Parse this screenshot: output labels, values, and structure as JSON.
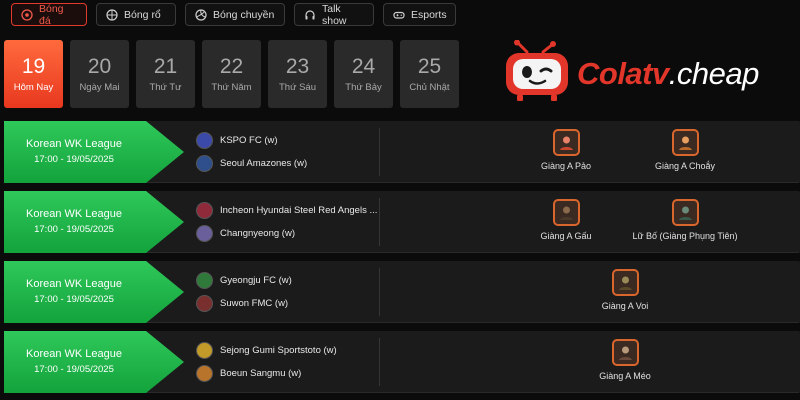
{
  "tabs": [
    {
      "label": "Bóng đá",
      "icon": "soccer-ball-icon",
      "active": true
    },
    {
      "label": "Bóng rổ",
      "icon": "basketball-icon",
      "active": false
    },
    {
      "label": "Bóng chuyền",
      "icon": "volleyball-icon",
      "active": false
    },
    {
      "label": "Talk show",
      "icon": "headphones-icon",
      "active": false
    },
    {
      "label": "Esports",
      "icon": "gamepad-icon",
      "active": false
    }
  ],
  "days": [
    {
      "num": "19",
      "label": "Hôm Nay",
      "active": true
    },
    {
      "num": "20",
      "label": "Ngày Mai",
      "active": false
    },
    {
      "num": "21",
      "label": "Thứ Tư",
      "active": false
    },
    {
      "num": "22",
      "label": "Thứ Năm",
      "active": false
    },
    {
      "num": "23",
      "label": "Thứ Sáu",
      "active": false
    },
    {
      "num": "24",
      "label": "Thứ Bảy",
      "active": false
    },
    {
      "num": "25",
      "label": "Chủ Nhật",
      "active": false
    }
  ],
  "logo": {
    "brand_a": "Colatv",
    "brand_b": ".cheap"
  },
  "matches": [
    {
      "league": "Korean WK League",
      "time": "17:00 - 19/05/2025",
      "home": {
        "name": "KSPO FC (w)",
        "color": "#3b4aa8"
      },
      "away": {
        "name": "Seoul Amazones (w)",
        "color": "#2e4f8c"
      },
      "casters": [
        "Giàng A Pảo",
        "Giàng A Choắy"
      ]
    },
    {
      "league": "Korean WK League",
      "time": "17:00 - 19/05/2025",
      "home": {
        "name": "Incheon Hyundai Steel Red Angels ...",
        "color": "#8f2a3a"
      },
      "away": {
        "name": "Changnyeong (w)",
        "color": "#6a5f9a"
      },
      "casters": [
        "Giàng A Gấu",
        "Lữ Bố (Giàng Phụng Tiên)"
      ]
    },
    {
      "league": "Korean WK League",
      "time": "17:00 - 19/05/2025",
      "home": {
        "name": "Gyeongju FC (w)",
        "color": "#2f7a3a"
      },
      "away": {
        "name": "Suwon FMC (w)",
        "color": "#7a2f2f"
      },
      "casters": [
        "Giàng A Voi"
      ]
    },
    {
      "league": "Korean WK League",
      "time": "17:00 - 19/05/2025",
      "home": {
        "name": "Sejong Gumi Sportstoto (w)",
        "color": "#c29a2a"
      },
      "away": {
        "name": "Boeun Sangmu (w)",
        "color": "#b8742a"
      },
      "casters": [
        "Giàng A Méo"
      ]
    }
  ],
  "colors": {
    "accent": "#e23b2e",
    "league_green": "#1fb24a",
    "background": "#0b0b0b",
    "row": "#1b1b1b"
  }
}
